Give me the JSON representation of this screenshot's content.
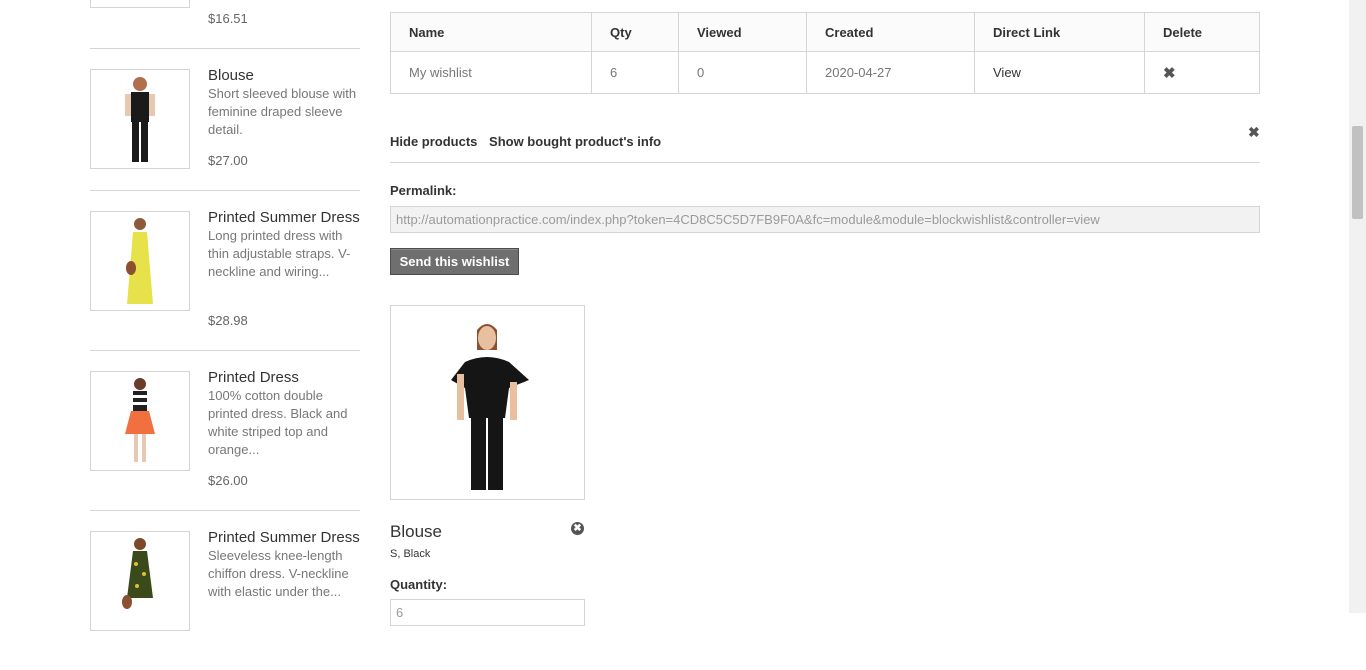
{
  "sidebar": {
    "top_price": "$16.51",
    "products": [
      {
        "name": "Blouse",
        "desc": "Short sleeved blouse with feminine draped sleeve detail.",
        "price": "$27.00",
        "dress_color": "#1a1a1a"
      },
      {
        "name": "Printed Summer Dress",
        "desc": "Long printed dress with thin adjustable straps. V-neckline and wiring...",
        "price": "$28.98",
        "dress_color": "#e8e24a"
      },
      {
        "name": "Printed Dress",
        "desc": "100% cotton double printed dress. Black and white striped top and orange...",
        "price": "$26.00",
        "dress_color": "#f07040"
      },
      {
        "name": "Printed Summer Dress",
        "desc": "Sleeveless knee-length chiffon dress. V-neckline with elastic under the...",
        "price": "",
        "dress_color": "#3a4a1a"
      }
    ]
  },
  "wishlist_table": {
    "headers": [
      "Name",
      "Qty",
      "Viewed",
      "Created",
      "Direct Link",
      "Delete"
    ],
    "row": {
      "name": "My wishlist",
      "qty": "6",
      "viewed": "0",
      "created": "2020-04-27",
      "link": "View",
      "delete_icon": "✖"
    }
  },
  "actions": {
    "hide_products": "Hide products",
    "show_bought": "Show bought product's info",
    "close_icon": "✖"
  },
  "permalink": {
    "label": "Permalink:",
    "value": "http://automationpractice.com/index.php?token=4CD8C5C5D7FB9F0A&fc=module&module=blockwishlist&controller=view"
  },
  "send_button": "Send this wishlist",
  "wishlist_product": {
    "name": "Blouse",
    "attributes": "S, Black",
    "quantity_label": "Quantity:",
    "quantity_value": "6",
    "remove_icon": "✖"
  }
}
